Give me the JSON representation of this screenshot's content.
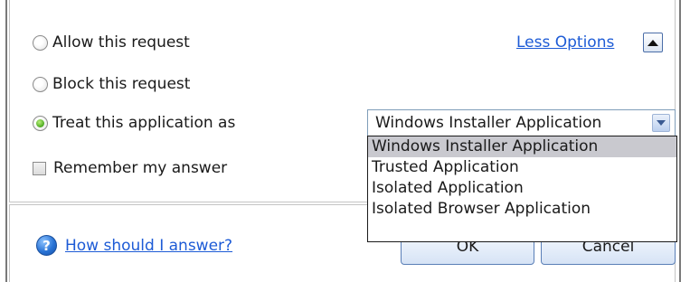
{
  "options": {
    "allow_label": "Allow this request",
    "block_label": "Block this request",
    "treat_label": "Treat this application as",
    "remember_label": "Remember my answer"
  },
  "less_options_label": "Less Options",
  "select": {
    "value": "Windows Installer Application",
    "items": [
      "Windows Installer Application",
      "Trusted Application",
      "Isolated Application",
      "Isolated Browser Application"
    ]
  },
  "help_label": "How should I answer?",
  "buttons": {
    "ok": "OK",
    "cancel": "Cancel"
  },
  "icons": {
    "help": "question-mark-icon",
    "collapse": "triangle-up-icon",
    "dropdown": "chevron-down-icon"
  },
  "help_glyph": "?"
}
